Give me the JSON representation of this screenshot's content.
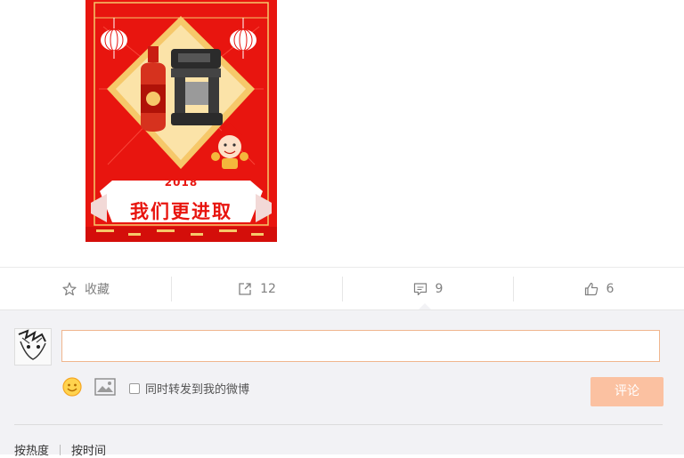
{
  "poster": {
    "year": "2018",
    "slogan": "我们更进取"
  },
  "actions": [
    {
      "icon": "star-icon",
      "label": "收藏"
    },
    {
      "icon": "share-icon",
      "label": "12"
    },
    {
      "icon": "comment-icon",
      "label": "9"
    },
    {
      "icon": "thumbs-up-icon",
      "label": "6"
    }
  ],
  "comment_box": {
    "input_value": "",
    "repost_label": "同时转发到我的微博",
    "repost_checked": false,
    "submit_label": "评论"
  },
  "sort_options": [
    "按热度",
    "按时间"
  ],
  "colors": {
    "poster_red": "#e8150f",
    "submit_disabled": "#fbc1a1",
    "input_border": "#f0b68e",
    "comment_bg": "#f2f2f5"
  }
}
